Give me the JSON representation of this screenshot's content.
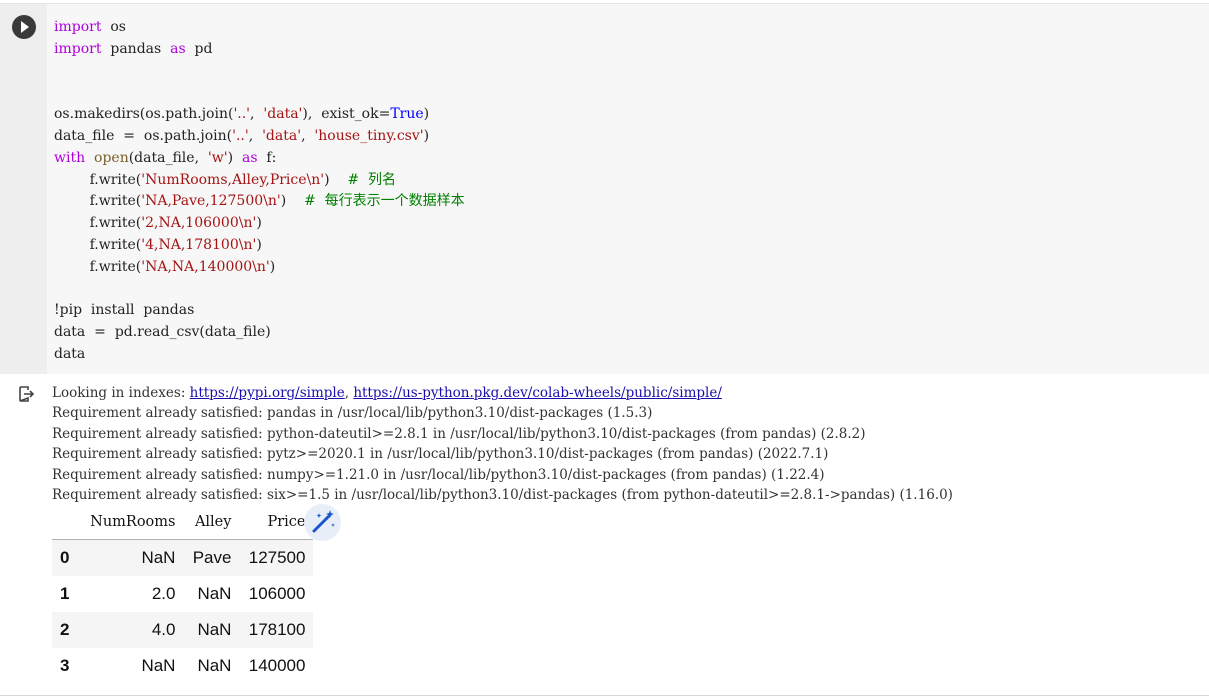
{
  "code_lines": [
    [
      {
        "c": "kw",
        "t": "import"
      },
      {
        "c": "",
        "t": "  os"
      }
    ],
    [
      {
        "c": "kw",
        "t": "import"
      },
      {
        "c": "",
        "t": "  pandas  "
      },
      {
        "c": "kw",
        "t": "as"
      },
      {
        "c": "",
        "t": "  pd"
      }
    ],
    [],
    [],
    [
      {
        "c": "",
        "t": "os.makedirs(os.path.join("
      },
      {
        "c": "str",
        "t": "'..'"
      },
      {
        "c": "",
        "t": ",  "
      },
      {
        "c": "str",
        "t": "'data'"
      },
      {
        "c": "",
        "t": "),  exist_ok="
      },
      {
        "c": "kv",
        "t": "True"
      },
      {
        "c": "",
        "t": ")"
      }
    ],
    [
      {
        "c": "",
        "t": "data_file  =  os.path.join("
      },
      {
        "c": "str",
        "t": "'..'"
      },
      {
        "c": "",
        "t": ",  "
      },
      {
        "c": "str",
        "t": "'data'"
      },
      {
        "c": "",
        "t": ",  "
      },
      {
        "c": "str",
        "t": "'house_tiny.csv'"
      },
      {
        "c": "",
        "t": ")"
      }
    ],
    [
      {
        "c": "kw",
        "t": "with"
      },
      {
        "c": "",
        "t": "  "
      },
      {
        "c": "bi",
        "t": "open"
      },
      {
        "c": "",
        "t": "(data_file,  "
      },
      {
        "c": "str",
        "t": "'w'"
      },
      {
        "c": "",
        "t": ")  "
      },
      {
        "c": "kw",
        "t": "as"
      },
      {
        "c": "",
        "t": "  f:"
      }
    ],
    [
      {
        "c": "",
        "t": "        f.write("
      },
      {
        "c": "str",
        "t": "'NumRooms,Alley,Price\\n'"
      },
      {
        "c": "",
        "t": ")    "
      },
      {
        "c": "cm",
        "t": "#  列名"
      }
    ],
    [
      {
        "c": "",
        "t": "        f.write("
      },
      {
        "c": "str",
        "t": "'NA,Pave,127500\\n'"
      },
      {
        "c": "",
        "t": ")    "
      },
      {
        "c": "cm",
        "t": "#  每行表示一个数据样本"
      }
    ],
    [
      {
        "c": "",
        "t": "        f.write("
      },
      {
        "c": "str",
        "t": "'2,NA,106000\\n'"
      },
      {
        "c": "",
        "t": ")"
      }
    ],
    [
      {
        "c": "",
        "t": "        f.write("
      },
      {
        "c": "str",
        "t": "'4,NA,178100\\n'"
      },
      {
        "c": "",
        "t": ")"
      }
    ],
    [
      {
        "c": "",
        "t": "        f.write("
      },
      {
        "c": "str",
        "t": "'NA,NA,140000\\n'"
      },
      {
        "c": "",
        "t": ")"
      }
    ],
    [],
    [
      {
        "c": "",
        "t": "!pip  install  pandas"
      }
    ],
    [
      {
        "c": "",
        "t": "data  =  pd.read_csv(data_file)"
      }
    ],
    [
      {
        "c": "",
        "t": "data"
      }
    ]
  ],
  "output": {
    "looking_prefix": "Looking in indexes: ",
    "link1": "https://pypi.org/simple",
    "sep": ", ",
    "link2": "https://us-python.pkg.dev/colab-wheels/public/simple/",
    "lines": [
      "Requirement already satisfied: pandas in /usr/local/lib/python3.10/dist-packages (1.5.3)",
      "Requirement already satisfied: python-dateutil>=2.8.1 in /usr/local/lib/python3.10/dist-packages (from pandas) (2.8.2)",
      "Requirement already satisfied: pytz>=2020.1 in /usr/local/lib/python3.10/dist-packages (from pandas) (2022.7.1)",
      "Requirement already satisfied: numpy>=1.21.0 in /usr/local/lib/python3.10/dist-packages (from pandas) (1.22.4)",
      "Requirement already satisfied: six>=1.5 in /usr/local/lib/python3.10/dist-packages (from python-dateutil>=2.8.1->pandas) (1.16.0)"
    ]
  },
  "table": {
    "columns": [
      "",
      "NumRooms",
      "Alley",
      "Price"
    ],
    "rows": [
      [
        "0",
        "NaN",
        "Pave",
        "127500"
      ],
      [
        "1",
        "2.0",
        "NaN",
        "106000"
      ],
      [
        "2",
        "4.0",
        "NaN",
        "178100"
      ],
      [
        "3",
        "NaN",
        "NaN",
        "140000"
      ]
    ]
  },
  "icons": {
    "run": "play-icon",
    "output": "output-exit-icon",
    "magic": "magic-wand-icon"
  },
  "colors": {
    "keyword": "#af00db",
    "string": "#a31515",
    "comment": "#008000",
    "constant": "#0000ff",
    "link": "#1a0dab"
  }
}
